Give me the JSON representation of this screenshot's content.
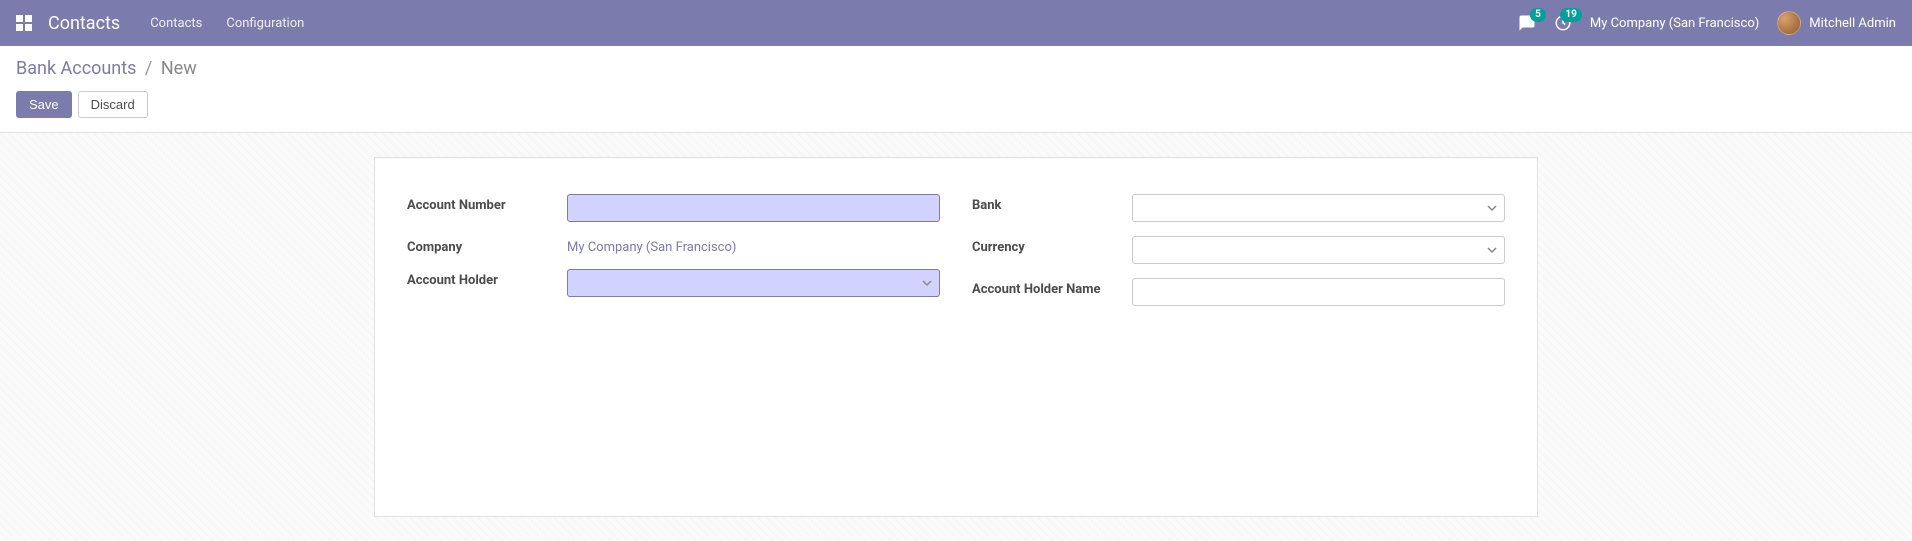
{
  "navbar": {
    "brand": "Contacts",
    "menu": [
      {
        "label": "Contacts"
      },
      {
        "label": "Configuration"
      }
    ],
    "messages_count": "5",
    "activities_count": "19",
    "company": "My Company (San Francisco)",
    "user": "Mitchell Admin"
  },
  "breadcrumb": {
    "parent": "Bank Accounts",
    "current": "New"
  },
  "buttons": {
    "save": "Save",
    "discard": "Discard"
  },
  "form": {
    "left": {
      "account_number": {
        "label": "Account Number",
        "value": ""
      },
      "company": {
        "label": "Company",
        "value": "My Company (San Francisco)"
      },
      "account_holder": {
        "label": "Account Holder",
        "value": ""
      }
    },
    "right": {
      "bank": {
        "label": "Bank",
        "value": ""
      },
      "currency": {
        "label": "Currency",
        "value": ""
      },
      "account_holder_name": {
        "label": "Account Holder Name",
        "value": ""
      }
    }
  }
}
